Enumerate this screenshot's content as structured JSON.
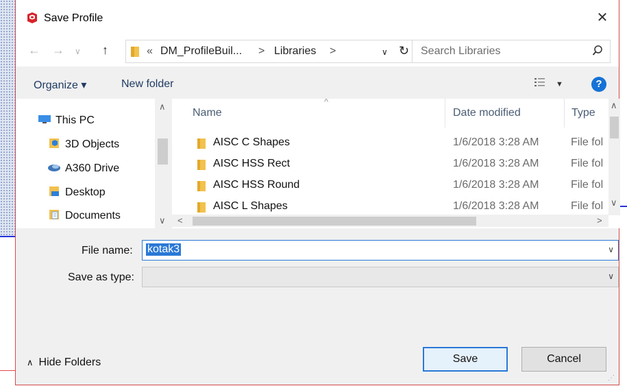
{
  "window": {
    "title": "Save Profile"
  },
  "nav": {
    "breadcrumb": [
      "«",
      "DM_ProfileBuil...",
      ">",
      "Libraries",
      ">"
    ],
    "search_placeholder": "Search Libraries"
  },
  "toolbar": {
    "organize_label": "Organize ▾",
    "new_folder_label": "New folder"
  },
  "tree": {
    "items": [
      {
        "label": "This PC",
        "icon": "this-pc-icon"
      },
      {
        "label": "3D Objects",
        "icon": "3d-objects-icon"
      },
      {
        "label": "A360 Drive",
        "icon": "a360-drive-icon"
      },
      {
        "label": "Desktop",
        "icon": "desktop-folder-icon"
      },
      {
        "label": "Documents",
        "icon": "documents-folder-icon"
      }
    ]
  },
  "file_list": {
    "columns": [
      "Name",
      "Date modified",
      "Type"
    ],
    "rows": [
      {
        "name": "AISC C Shapes",
        "date": "1/6/2018 3:28 AM",
        "type": "File fol"
      },
      {
        "name": "AISC HSS Rect",
        "date": "1/6/2018 3:28 AM",
        "type": "File fol"
      },
      {
        "name": "AISC HSS Round",
        "date": "1/6/2018 3:28 AM",
        "type": "File fol"
      },
      {
        "name": "AISC L Shapes",
        "date": "1/6/2018 3:28 AM",
        "type": "File fol"
      }
    ]
  },
  "form": {
    "file_name_label": "File name:",
    "file_name_value": "kotak3",
    "save_as_type_label": "Save as type:",
    "save_as_type_value": ""
  },
  "footer": {
    "hide_folders_label": "Hide Folders",
    "save_label": "Save",
    "cancel_label": "Cancel"
  },
  "colors": {
    "accent": "#2a78d6",
    "help": "#1572d6",
    "folder": "#f2c14e",
    "app_icon": "#d8232a"
  }
}
